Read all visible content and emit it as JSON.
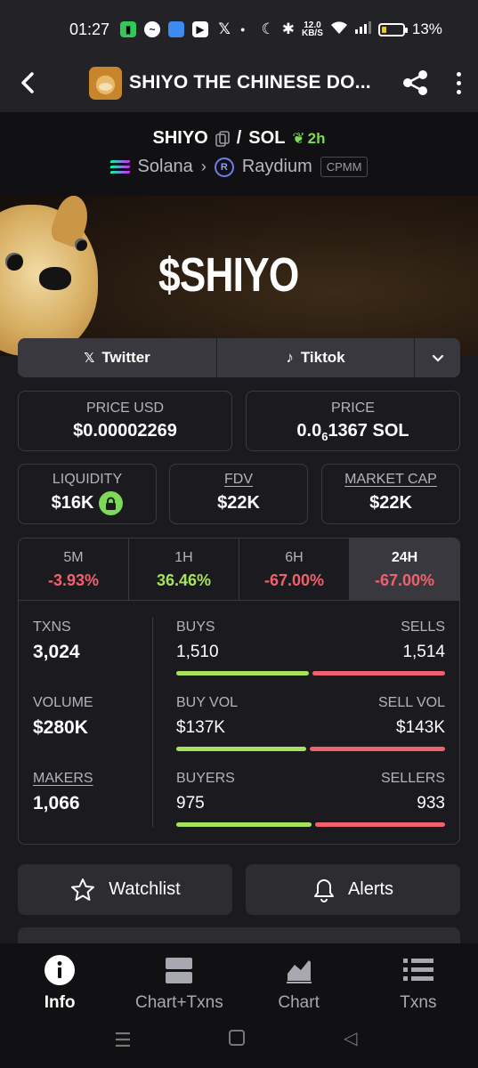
{
  "status_bar": {
    "time": "01:27",
    "net_speed_top": "12.0",
    "net_speed_unit": "KB/S",
    "battery": "13%"
  },
  "header": {
    "title": "SHIYO THE CHINESE DO...",
    "logo_icon": "doge-token-logo"
  },
  "pair": {
    "base": "SHIYO",
    "separator": "/",
    "quote": "SOL",
    "age": "2h",
    "chain": "Solana",
    "dex": "Raydium",
    "pool_type": "CPMM"
  },
  "banner": {
    "text": "$SHIYO"
  },
  "socials": {
    "twitter": "Twitter",
    "tiktok": "Tiktok"
  },
  "metrics": {
    "price_usd_label": "PRICE USD",
    "price_usd": "$0.00002269",
    "price_label": "PRICE",
    "price_prefix": "0.0",
    "price_sub": "6",
    "price_rest": "1367 SOL",
    "liquidity_label": "LIQUIDITY",
    "liquidity": "$16K",
    "fdv_label": "FDV",
    "fdv": "$22K",
    "mcap_label": "MARKET CAP",
    "mcap": "$22K"
  },
  "periods": [
    {
      "label": "5M",
      "change": "-3.93%"
    },
    {
      "label": "1H",
      "change": "36.46%"
    },
    {
      "label": "6H",
      "change": "-67.00%"
    },
    {
      "label": "24H",
      "change": "-67.00%"
    }
  ],
  "stats": {
    "txns_label": "TXNS",
    "txns": "3,024",
    "volume_label": "VOLUME",
    "volume": "$280K",
    "makers_label": "MAKERS",
    "makers": "1,066",
    "buys_label": "BUYS",
    "buys": "1,510",
    "sells_label": "SELLS",
    "sells": "1,514",
    "buy_vol_label": "BUY VOL",
    "buy_vol": "$137K",
    "sell_vol_label": "SELL VOL",
    "sell_vol": "$143K",
    "buyers_label": "BUYERS",
    "buyers": "975",
    "sellers_label": "SELLERS",
    "sellers": "933"
  },
  "actions": {
    "watchlist": "Watchlist",
    "alerts": "Alerts"
  },
  "nav": [
    {
      "label": "Info",
      "icon": "info-icon"
    },
    {
      "label": "Chart+Txns",
      "icon": "split-view-icon"
    },
    {
      "label": "Chart",
      "icon": "chart-icon"
    },
    {
      "label": "Txns",
      "icon": "list-icon"
    }
  ],
  "colors": {
    "positive": "#a7e25c",
    "negative": "#f0616d",
    "background": "#1b1b1f"
  }
}
